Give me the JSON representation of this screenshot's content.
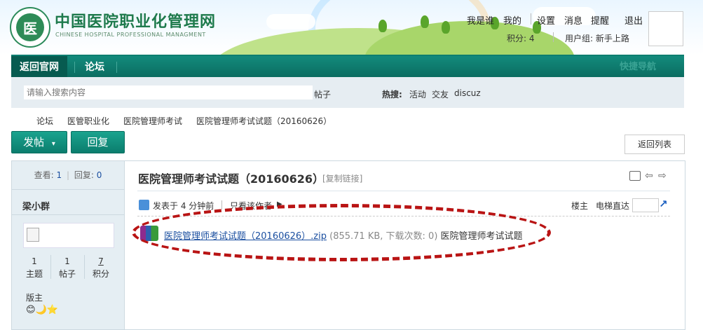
{
  "site": {
    "title": "中国医院职业化管理网",
    "subtitle": "CHINESE HOSPITAL PROFESSIONAL MANAGMENT",
    "logo_text": "医"
  },
  "top_links": [
    "我是谁",
    "我的",
    "设置",
    "消息",
    "提醒",
    "退出"
  ],
  "user_meta": {
    "points": "积分: 4",
    "group": "用户组: 新手上路"
  },
  "nav": {
    "items": [
      "返回官网",
      "论坛"
    ],
    "quick_nav": "快捷导航"
  },
  "search": {
    "placeholder": "请输入搜索内容",
    "type": "帖子",
    "hot_label": "热搜:",
    "hot_terms": [
      "活动",
      "交友",
      "discuz"
    ]
  },
  "breadcrumb": [
    "论坛",
    "医管职业化",
    "医院管理师考试",
    "医院管理师考试试题（20160626）"
  ],
  "buttons": {
    "post": "发帖",
    "post_arrow": "▾",
    "reply": "回复",
    "back_to_list": "返回列表"
  },
  "thread_stats": {
    "views_label": "查看:",
    "views": "1",
    "replies_label": "回复:",
    "replies": "0"
  },
  "author": {
    "name": "梁小群",
    "stats": [
      {
        "value": "1",
        "label": "主题"
      },
      {
        "value": "1",
        "label": "帖子"
      },
      {
        "value": "7",
        "label": "积分"
      }
    ],
    "rank": "版主",
    "rank_icons": [
      "😊",
      "🌙",
      "⭐"
    ]
  },
  "thread": {
    "title": "医院管理师考试试题（20160626）",
    "copy_link": "[复制链接]"
  },
  "post_meta": {
    "posted": "发表于 4 分钟前",
    "only_author": "只看该作者",
    "floor": "楼主",
    "jump": "电梯直达"
  },
  "attachment": {
    "filename": "医院管理师考试试题（20160626）.zip",
    "info": "(855.71 KB, 下载次数: 0)",
    "desc": "医院管理师考试试题"
  },
  "colors": {
    "brand": "#0d7e70",
    "accent_red": "#b91414",
    "link": "#1b4fa0"
  }
}
